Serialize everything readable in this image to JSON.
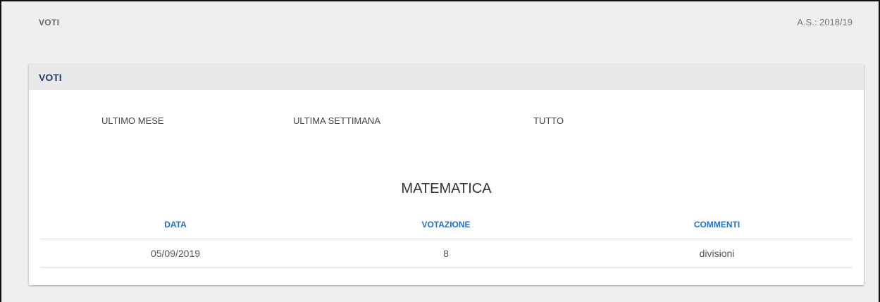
{
  "header": {
    "title": "VOTI",
    "school_year": "A.S.: 2018/19"
  },
  "card": {
    "title": "VOTI",
    "filters": [
      "ULTIMO MESE",
      "ULTIMA SETTIMANA",
      "TUTTO"
    ],
    "subject": "MATEMATICA",
    "table": {
      "columns": [
        "DATA",
        "VOTAZIONE",
        "COMMENTI"
      ],
      "rows": [
        [
          "05/09/2019",
          "8",
          "divisioni"
        ]
      ]
    }
  },
  "colors": {
    "card_title": "#283a6b",
    "column_header": "#1f6fd1",
    "page_background": "#efefef"
  }
}
